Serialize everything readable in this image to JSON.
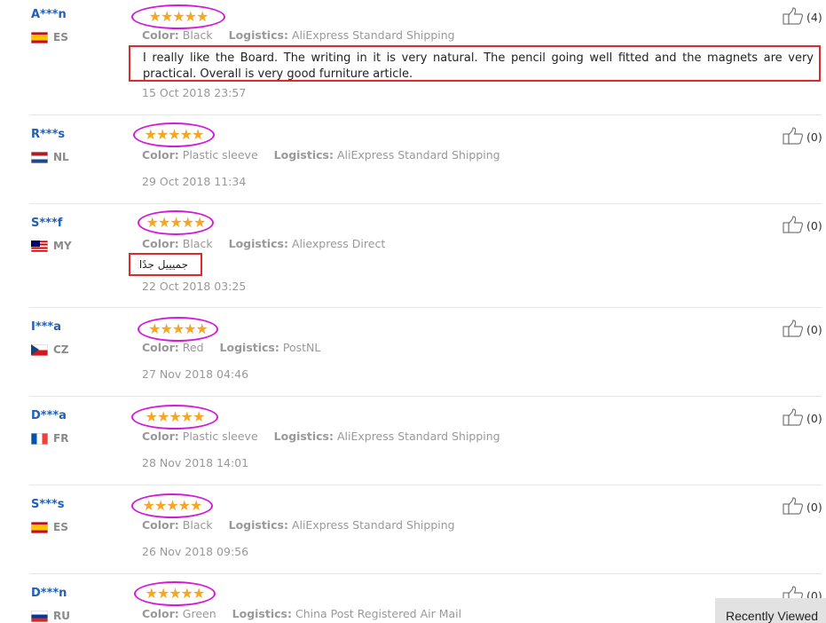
{
  "labels": {
    "color": "Color:",
    "logistics": "Logistics:"
  },
  "stars_glyph": "★★★★★",
  "reviews": [
    {
      "name": "A***n",
      "country": "ES",
      "rating": 5,
      "color": "Black",
      "logistics": "AliExpress Standard Shipping",
      "comment": "I really like the Board. The writing in it is very natural. The pencil going well fitted and the magnets are very practical. Overall is very good furniture article.",
      "date": "15 Oct 2018 23:57",
      "helpful": "(4)"
    },
    {
      "name": "R***s",
      "country": "NL",
      "rating": 5,
      "color": "Plastic sleeve",
      "logistics": "AliExpress Standard Shipping",
      "comment": "",
      "date": "29 Oct 2018 11:34",
      "helpful": "(0)"
    },
    {
      "name": "S***f",
      "country": "MY",
      "rating": 5,
      "color": "Black",
      "logistics": "Aliexpress Direct",
      "comment": "جميييل جدًا",
      "date": "22 Oct 2018 03:25",
      "helpful": "(0)"
    },
    {
      "name": "I***a",
      "country": "CZ",
      "rating": 5,
      "color": "Red",
      "logistics": "PostNL",
      "comment": "",
      "date": "27 Nov 2018 04:46",
      "helpful": "(0)"
    },
    {
      "name": "D***a",
      "country": "FR",
      "rating": 5,
      "color": "Plastic sleeve",
      "logistics": "AliExpress Standard Shipping",
      "comment": "",
      "date": "28 Nov 2018 14:01",
      "helpful": "(0)"
    },
    {
      "name": "S***s",
      "country": "ES",
      "rating": 5,
      "color": "Black",
      "logistics": "AliExpress Standard Shipping",
      "comment": "",
      "date": "26 Nov 2018 09:56",
      "helpful": "(0)"
    },
    {
      "name": "D***n",
      "country": "RU",
      "rating": 5,
      "color": "Green",
      "logistics": "China Post Registered Air Mail",
      "comment": "",
      "date": "",
      "helpful": "(0)"
    }
  ],
  "recently_viewed": "Recently Viewed"
}
